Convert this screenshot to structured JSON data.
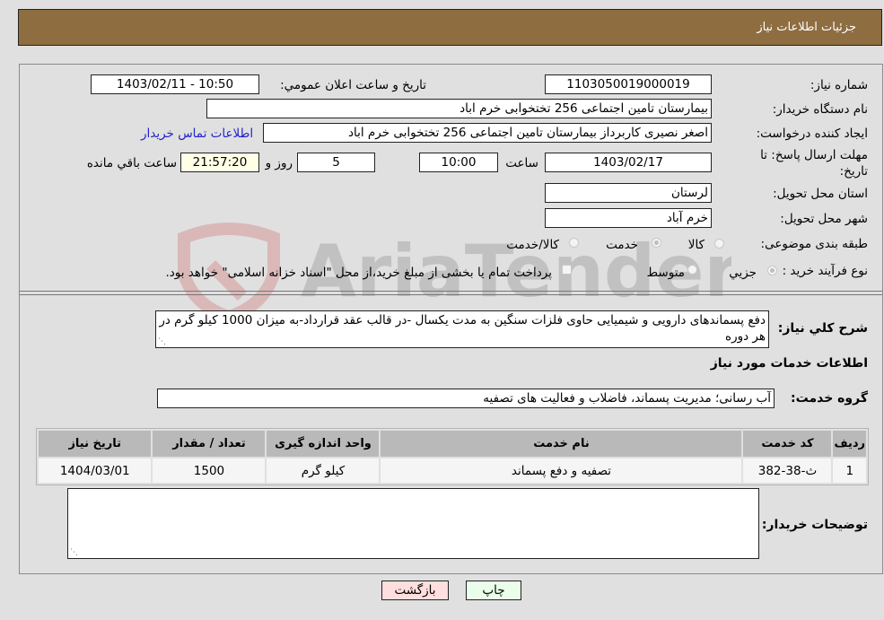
{
  "header": {
    "title": "جزئیات اطلاعات نیاز"
  },
  "fields": {
    "need_number": {
      "label": "شماره نیاز:",
      "value": "1103050019000019"
    },
    "announce_datetime": {
      "label": "تاریخ و ساعت اعلان عمومي:",
      "value": "1403/02/11 - 10:50"
    },
    "buyer_org": {
      "label": "نام دستگاه خریدار:",
      "value": "بیمارستان تامین اجتماعی  256 تختخوابی خرم اباد"
    },
    "requester": {
      "label": "ایجاد کننده درخواست:",
      "value": "اصغر نصیری کاربرداز بیمارستان تامین اجتماعی  256 تختخوابی خرم اباد"
    },
    "buyer_contact_link": "اطلاعات تماس خریدار",
    "deadline": {
      "label": "مهلت ارسال پاسخ: تا تاریخ:",
      "date": "1403/02/17",
      "time_label": "ساعت",
      "time": "10:00",
      "days": "5",
      "days_label": "روز و",
      "remaining": "21:57:20",
      "remaining_label": "ساعت باقي مانده"
    },
    "province": {
      "label": "استان محل تحویل:",
      "value": "لرستان"
    },
    "city": {
      "label": "شهر محل تحویل:",
      "value": "خرم آباد"
    },
    "category": {
      "label": "طبقه بندی موضوعی:",
      "options": [
        "کالا",
        "خدمت",
        "کالا/خدمت"
      ],
      "selected": "خدمت"
    },
    "purchase_type": {
      "label": "نوع فرآیند خرید :",
      "options": [
        "جزيي",
        "متوسط"
      ],
      "selected": "جزيي",
      "treasury_note": "پرداخت تمام یا بخشی از مبلغ خرید،از محل \"اسناد خزانه اسلامی\" خواهد بود."
    },
    "description": {
      "label": "شرح كلي نياز:",
      "value": "دفع پسماندهای دارویی و شیمیایی حاوی فلزات سنگین به مدت یکسال -در قالب عقد قرارداد-به میزان 1000 کیلو گرم در هر دوره"
    }
  },
  "services_section": {
    "title": "اطلاعات خدمات مورد نیاز",
    "group_label": "گروه خدمت:",
    "group_value": "آب رسانی؛ مدیریت پسماند، فاضلاب و فعالیت های تصفیه"
  },
  "table": {
    "headers": [
      "ردیف",
      "کد خدمت",
      "نام خدمت",
      "واحد اندازه گیری",
      "تعداد / مقدار",
      "تاریخ نیاز"
    ],
    "rows": [
      [
        "1",
        "ث-38-382",
        "تصفیه و دفع پسماند",
        "کیلو گرم",
        "1500",
        "1404/03/01"
      ]
    ]
  },
  "buyer_notes": {
    "label": "توضیحات خریدار:",
    "value": ""
  },
  "buttons": {
    "print": "چاپ",
    "back": "بازگشت"
  },
  "watermark": {
    "text": "AriaTender.neT"
  },
  "colors": {
    "header_bg": "#8e6d41",
    "link": "#2222cc",
    "print_bg": "#eaffea",
    "back_bg": "#ffdede",
    "remaining_bg": "#ffffe6"
  }
}
